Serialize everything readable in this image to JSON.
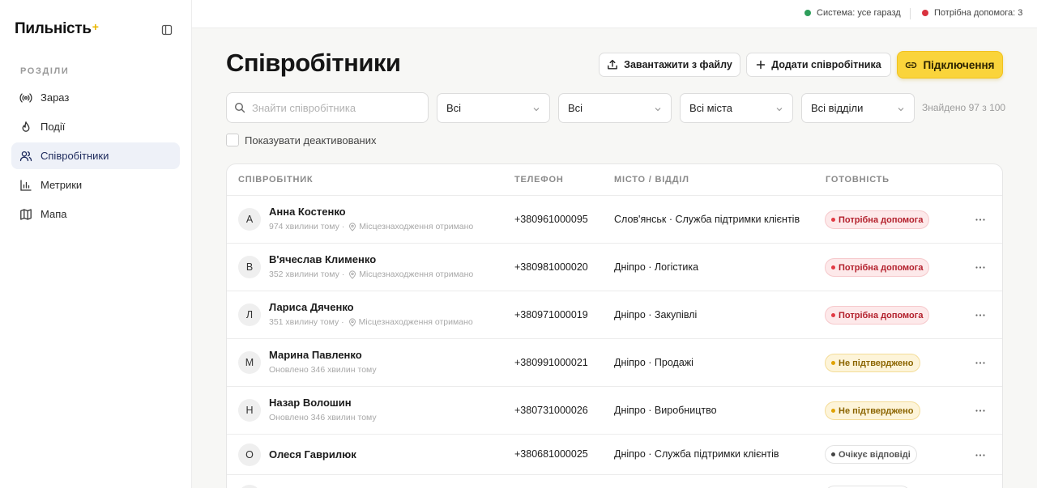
{
  "brand": {
    "name": "Пильність",
    "plus": "+"
  },
  "sidebar": {
    "section_title": "РОЗДІЛИ",
    "items": [
      {
        "label": "Зараз",
        "icon": "broadcast-icon",
        "active": false
      },
      {
        "label": "Події",
        "icon": "flame-icon",
        "active": false
      },
      {
        "label": "Співробітники",
        "icon": "users-icon",
        "active": true
      },
      {
        "label": "Метрики",
        "icon": "bar-chart-icon",
        "active": false
      },
      {
        "label": "Мапа",
        "icon": "map-icon",
        "active": false
      }
    ]
  },
  "topbar": {
    "system_status": "Система: усе гаразд",
    "help_status": "Потрібна допомога: 3",
    "colors": {
      "ok": "#2e9e5b",
      "alert": "#d9333f"
    }
  },
  "header": {
    "title": "Співробітники",
    "upload_button": "Завантажити з файлу",
    "add_button": "Додати співробітника",
    "connect_button": "Підключення"
  },
  "filters": {
    "search_placeholder": "Знайти співробітника",
    "select_1": "Всі",
    "select_2": "Всі",
    "select_city": "Всі міста",
    "select_department": "Всі відділи",
    "found_text": "Знайдено 97 з 100",
    "show_deactivated": "Показувати деактивованих"
  },
  "table": {
    "headers": {
      "employee": "СПІВРОБІТНИК",
      "phone": "ТЕЛЕФОН",
      "location": "МІСТО / ВІДДІЛ",
      "readiness": "ГОТОВНІСТЬ"
    },
    "rows": [
      {
        "initial": "А",
        "name": "Анна Костенко",
        "time": "974 хвилини тому ·",
        "location_note": "Місцезнаходження отримано",
        "phone": "+380961000095",
        "location": "Слов'янськ · Служба підтримки клієнтів",
        "status": "Потрібна допомога",
        "status_kind": "red"
      },
      {
        "initial": "В",
        "name": "В'ячеслав Клименко",
        "time": "352 хвилини тому ·",
        "location_note": "Місцезнаходження отримано",
        "phone": "+380981000020",
        "location": "Дніпро · Логістика",
        "status": "Потрібна допомога",
        "status_kind": "red"
      },
      {
        "initial": "Л",
        "name": "Лариса Дяченко",
        "time": "351 хвилину тому ·",
        "location_note": "Місцезнаходження отримано",
        "phone": "+380971000019",
        "location": "Дніпро · Закупівлі",
        "status": "Потрібна допомога",
        "status_kind": "red"
      },
      {
        "initial": "М",
        "name": "Марина Павленко",
        "time": "Оновлено 346 хвилин тому",
        "location_note": "",
        "phone": "+380991000021",
        "location": "Дніпро · Продажі",
        "status": "Не підтверджено",
        "status_kind": "yellow"
      },
      {
        "initial": "Н",
        "name": "Назар Волошин",
        "time": "Оновлено 346 хвилин тому",
        "location_note": "",
        "phone": "+380731000026",
        "location": "Дніпро · Виробництво",
        "status": "Не підтверджено",
        "status_kind": "yellow"
      },
      {
        "initial": "О",
        "name": "Олеся Гаврилюк",
        "time": "",
        "location_note": "",
        "phone": "+380681000025",
        "location": "Дніпро · Служба підтримки клієнтів",
        "status": "Очікує відповіді",
        "status_kind": "grey"
      }
    ]
  }
}
